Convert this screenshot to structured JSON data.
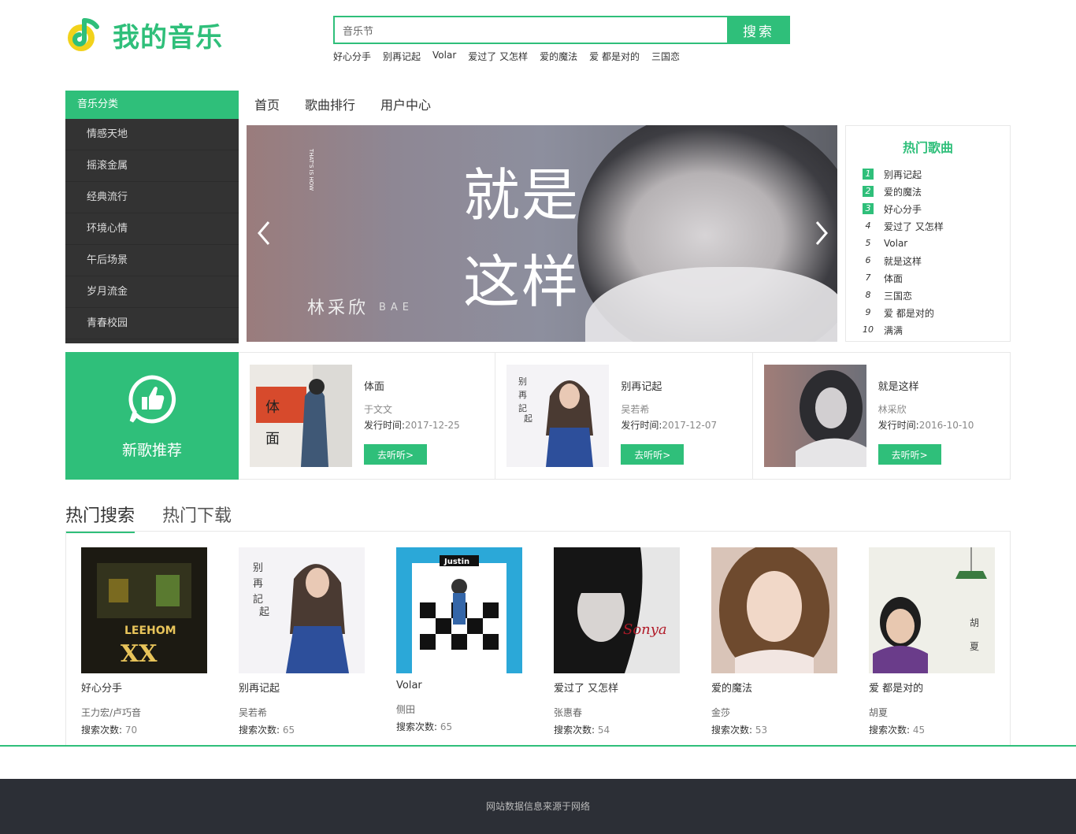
{
  "brand": {
    "title": "我的音乐",
    "accent": "#2fbf7a"
  },
  "search": {
    "value": "音乐节",
    "button_label": "搜索",
    "hot_words": [
      "好心分手",
      "别再记起",
      "Volar",
      "爱过了 又怎样",
      "爱的魔法",
      "爱 都是对的",
      "三国恋"
    ]
  },
  "sidebar": {
    "title": "音乐分类",
    "items": [
      {
        "label": "情感天地"
      },
      {
        "label": "摇滚金属"
      },
      {
        "label": "经典流行"
      },
      {
        "label": "环境心情"
      },
      {
        "label": "午后场景"
      },
      {
        "label": "岁月流金"
      },
      {
        "label": "青春校园"
      }
    ]
  },
  "nav": {
    "items": [
      {
        "label": "首页"
      },
      {
        "label": "歌曲排行"
      },
      {
        "label": "用户中心"
      }
    ]
  },
  "banner": {
    "line1": "就是",
    "line2": "这样",
    "artist": "林采欣",
    "artist_en": "BAE",
    "small_text": "THAT'S IS HOW"
  },
  "hot_songs": {
    "title": "热门歌曲",
    "items": [
      {
        "rank": "1",
        "name": "别再记起"
      },
      {
        "rank": "2",
        "name": "爱的魔法"
      },
      {
        "rank": "3",
        "name": "好心分手"
      },
      {
        "rank": "4",
        "name": "爱过了 又怎样"
      },
      {
        "rank": "5",
        "name": "Volar"
      },
      {
        "rank": "6",
        "name": "就是这样"
      },
      {
        "rank": "7",
        "name": "体面"
      },
      {
        "rank": "8",
        "name": "三国恋"
      },
      {
        "rank": "9",
        "name": "爱 都是对的"
      },
      {
        "rank": "10",
        "name": "满满"
      }
    ]
  },
  "new_songs": {
    "label": "新歌推荐",
    "date_label": "发行时间:",
    "listen_label": "去听听>",
    "items": [
      {
        "title": "体面",
        "artist": "于文文",
        "date": "2017-12-25"
      },
      {
        "title": "别再记起",
        "artist": "吴若希",
        "date": "2017-12-07"
      },
      {
        "title": "就是这样",
        "artist": "林采欣",
        "date": "2016-10-10"
      }
    ]
  },
  "tabs": {
    "items": [
      {
        "label": "热门搜索"
      },
      {
        "label": "热门下载"
      }
    ]
  },
  "hot_search": {
    "count_label": "搜索次数:",
    "items": [
      {
        "title": "好心分手",
        "artist": "王力宏/卢巧音",
        "count": "70"
      },
      {
        "title": "别再记起",
        "artist": "吴若希",
        "count": "65"
      },
      {
        "title": "Volar",
        "artist": "侧田",
        "count": "65"
      },
      {
        "title": "爱过了 又怎样",
        "artist": "张惠春",
        "count": "54"
      },
      {
        "title": "爱的魔法",
        "artist": "金莎",
        "count": "53"
      },
      {
        "title": "爱 都是对的",
        "artist": "胡夏",
        "count": "45"
      }
    ]
  },
  "footer": {
    "text": "网站数据信息来源于网络"
  }
}
